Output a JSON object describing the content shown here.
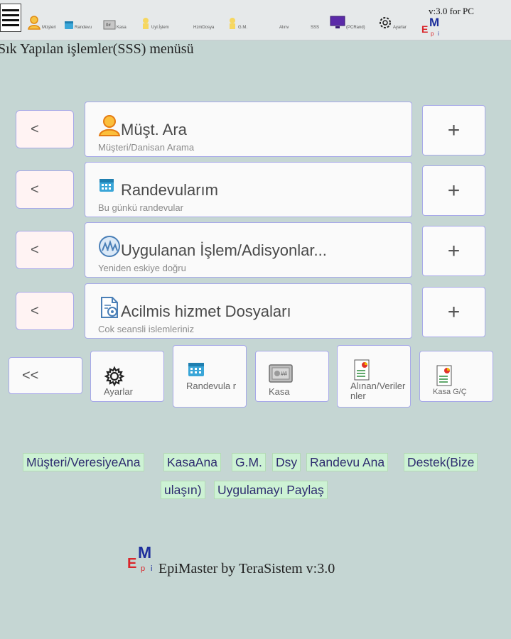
{
  "toolbar": {
    "items": [
      {
        "label": "Müşteri",
        "icon": "person-icon"
      },
      {
        "label": "Randevu",
        "icon": "calendar-icon"
      },
      {
        "label": "Kasa",
        "icon": "safe-icon"
      },
      {
        "label": "Uyl.İşlem",
        "icon": "service-icon"
      },
      {
        "label": "HzmDosya",
        "icon": "file-icon"
      },
      {
        "label": "G.M.",
        "icon": "money-icon"
      },
      {
        "label": "Alınv",
        "icon": "list-icon"
      },
      {
        "label": "SSS",
        "icon": "faq-icon"
      },
      {
        "label": "(PCRand)",
        "icon": "monitor-icon"
      },
      {
        "label": "Ayarlar",
        "icon": "gear-icon"
      }
    ],
    "version": "v:3.0 for PC",
    "logo": "EpiMaster"
  },
  "page_title": "Sık Yapılan işlemler(SSS) menüsü",
  "rows": [
    {
      "left": "<",
      "title": "Müşt. Ara",
      "subtitle": "Müşteri/Danisan Arama",
      "right": "+",
      "icon": "person-icon"
    },
    {
      "left": "<",
      "title": "Randevularım",
      "subtitle": "Bu günkü randevular",
      "right": "+",
      "icon": "calendar-icon"
    },
    {
      "left": "<",
      "title": "Uygulanan İşlem/Adisyonlar...",
      "subtitle": "Yeniden eskiye doğru",
      "right": "+",
      "icon": "service-icon"
    },
    {
      "left": "<",
      "title": "Acilmis hizmet Dosyaları",
      "subtitle": "Cok seansli islemleriniz",
      "right": "+",
      "icon": "file-icon"
    }
  ],
  "back_button": "<<",
  "tiles": [
    {
      "label": "Ayarlar",
      "icon": "gear-icon"
    },
    {
      "label": "Randevula r",
      "icon": "calendar-icon"
    },
    {
      "label": "Kasa",
      "icon": "safe-icon"
    },
    {
      "label": "Alınan/Veriler nler",
      "icon": "report-icon"
    },
    {
      "label": "Kasa G/Ç",
      "icon": "report-icon"
    }
  ],
  "links": [
    "Müşteri/VeresiyeAna",
    "KasaAna",
    "G.M.",
    "Dsy",
    "Randevu Ana",
    "Destek(Bize",
    "ulaşın)",
    "Uygulamayı Paylaş"
  ],
  "footer": {
    "text": "EpiMaster by TeraSistem v:3.0",
    "logo": "EpiMaster"
  },
  "colors": {
    "background": "#c5d6d3",
    "border": "#a7a9e8",
    "link_bg": "#cdf2d4",
    "link_text": "#2e2c70",
    "logo_red": "#d9262b",
    "logo_blue": "#1d2f9c"
  }
}
